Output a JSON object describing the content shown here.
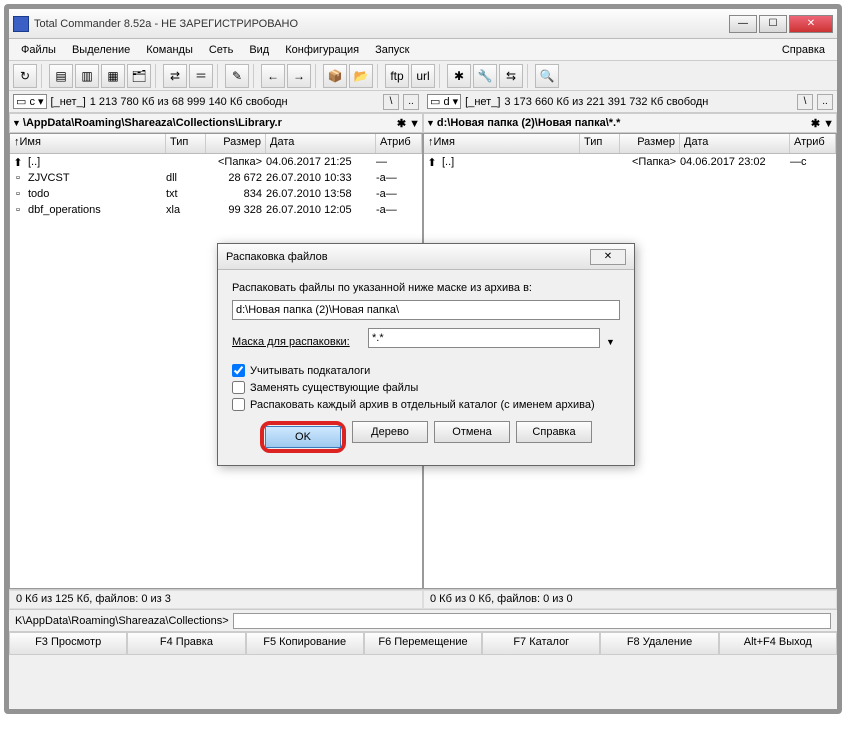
{
  "window": {
    "title": "Total Commander 8.52a - НЕ ЗАРЕГИСТРИРОВАНО"
  },
  "menu": {
    "items": [
      "Файлы",
      "Выделение",
      "Команды",
      "Сеть",
      "Вид",
      "Конфигурация",
      "Запуск"
    ],
    "help": "Справка"
  },
  "drives": {
    "left": {
      "drive": "c",
      "label": "[_нет_]",
      "info": "1 213 780 Кб из 68 999 140 Кб свободн"
    },
    "right": {
      "drive": "d",
      "label": "[_нет_]",
      "info": "3 173 660 Кб из 221 391 732 Кб свободн"
    }
  },
  "paths": {
    "left": "\\AppData\\Roaming\\Shareaza\\Collections\\Library.r",
    "right": "d:\\Новая папка (2)\\Новая папка\\*.*"
  },
  "cols": {
    "name": "Имя",
    "ext": "Тип",
    "size": "Размер",
    "date": "Дата",
    "attr": "Атриб"
  },
  "left_files": [
    {
      "ic": "⬆",
      "name": "[..]",
      "ext": "",
      "size": "<Папка>",
      "date": "04.06.2017 21:25",
      "attr": "—"
    },
    {
      "ic": "",
      "name": "ZJVCST",
      "ext": "dll",
      "size": "28 672",
      "date": "26.07.2010 10:33",
      "attr": "-a—"
    },
    {
      "ic": "",
      "name": "todo",
      "ext": "txt",
      "size": "834",
      "date": "26.07.2010 13:58",
      "attr": "-a—"
    },
    {
      "ic": "",
      "name": "dbf_operations",
      "ext": "xla",
      "size": "99 328",
      "date": "26.07.2010 12:05",
      "attr": "-a—"
    }
  ],
  "right_files": [
    {
      "ic": "⬆",
      "name": "[..]",
      "ext": "",
      "size": "<Папка>",
      "date": "04.06.2017 23:02",
      "attr": "—c"
    }
  ],
  "status": {
    "left": "0 Кб из 125 Кб, файлов: 0 из 3",
    "right": "0 Кб из 0 Кб, файлов: 0 из 0"
  },
  "cmdline": {
    "prompt": "K\\AppData\\Roaming\\Shareaza\\Collections>"
  },
  "fkeys": [
    "F3 Просмотр",
    "F4 Правка",
    "F5 Копирование",
    "F6 Перемещение",
    "F7 Каталог",
    "F8 Удаление",
    "Alt+F4 Выход"
  ],
  "dialog": {
    "title": "Распаковка файлов",
    "prompt": "Распаковать файлы по указанной ниже маске из архива в:",
    "path": "d:\\Новая папка (2)\\Новая папка\\",
    "mask_label": "Маска для распаковки:",
    "mask_value": "*.*",
    "chk1": "Учитывать подкаталоги",
    "chk2": "Заменять существующие файлы",
    "chk3": "Распаковать каждый архив в отдельный каталог (с именем архива)",
    "btns": {
      "ok": "OK",
      "tree": "Дерево",
      "cancel": "Отмена",
      "help": "Справка"
    }
  }
}
